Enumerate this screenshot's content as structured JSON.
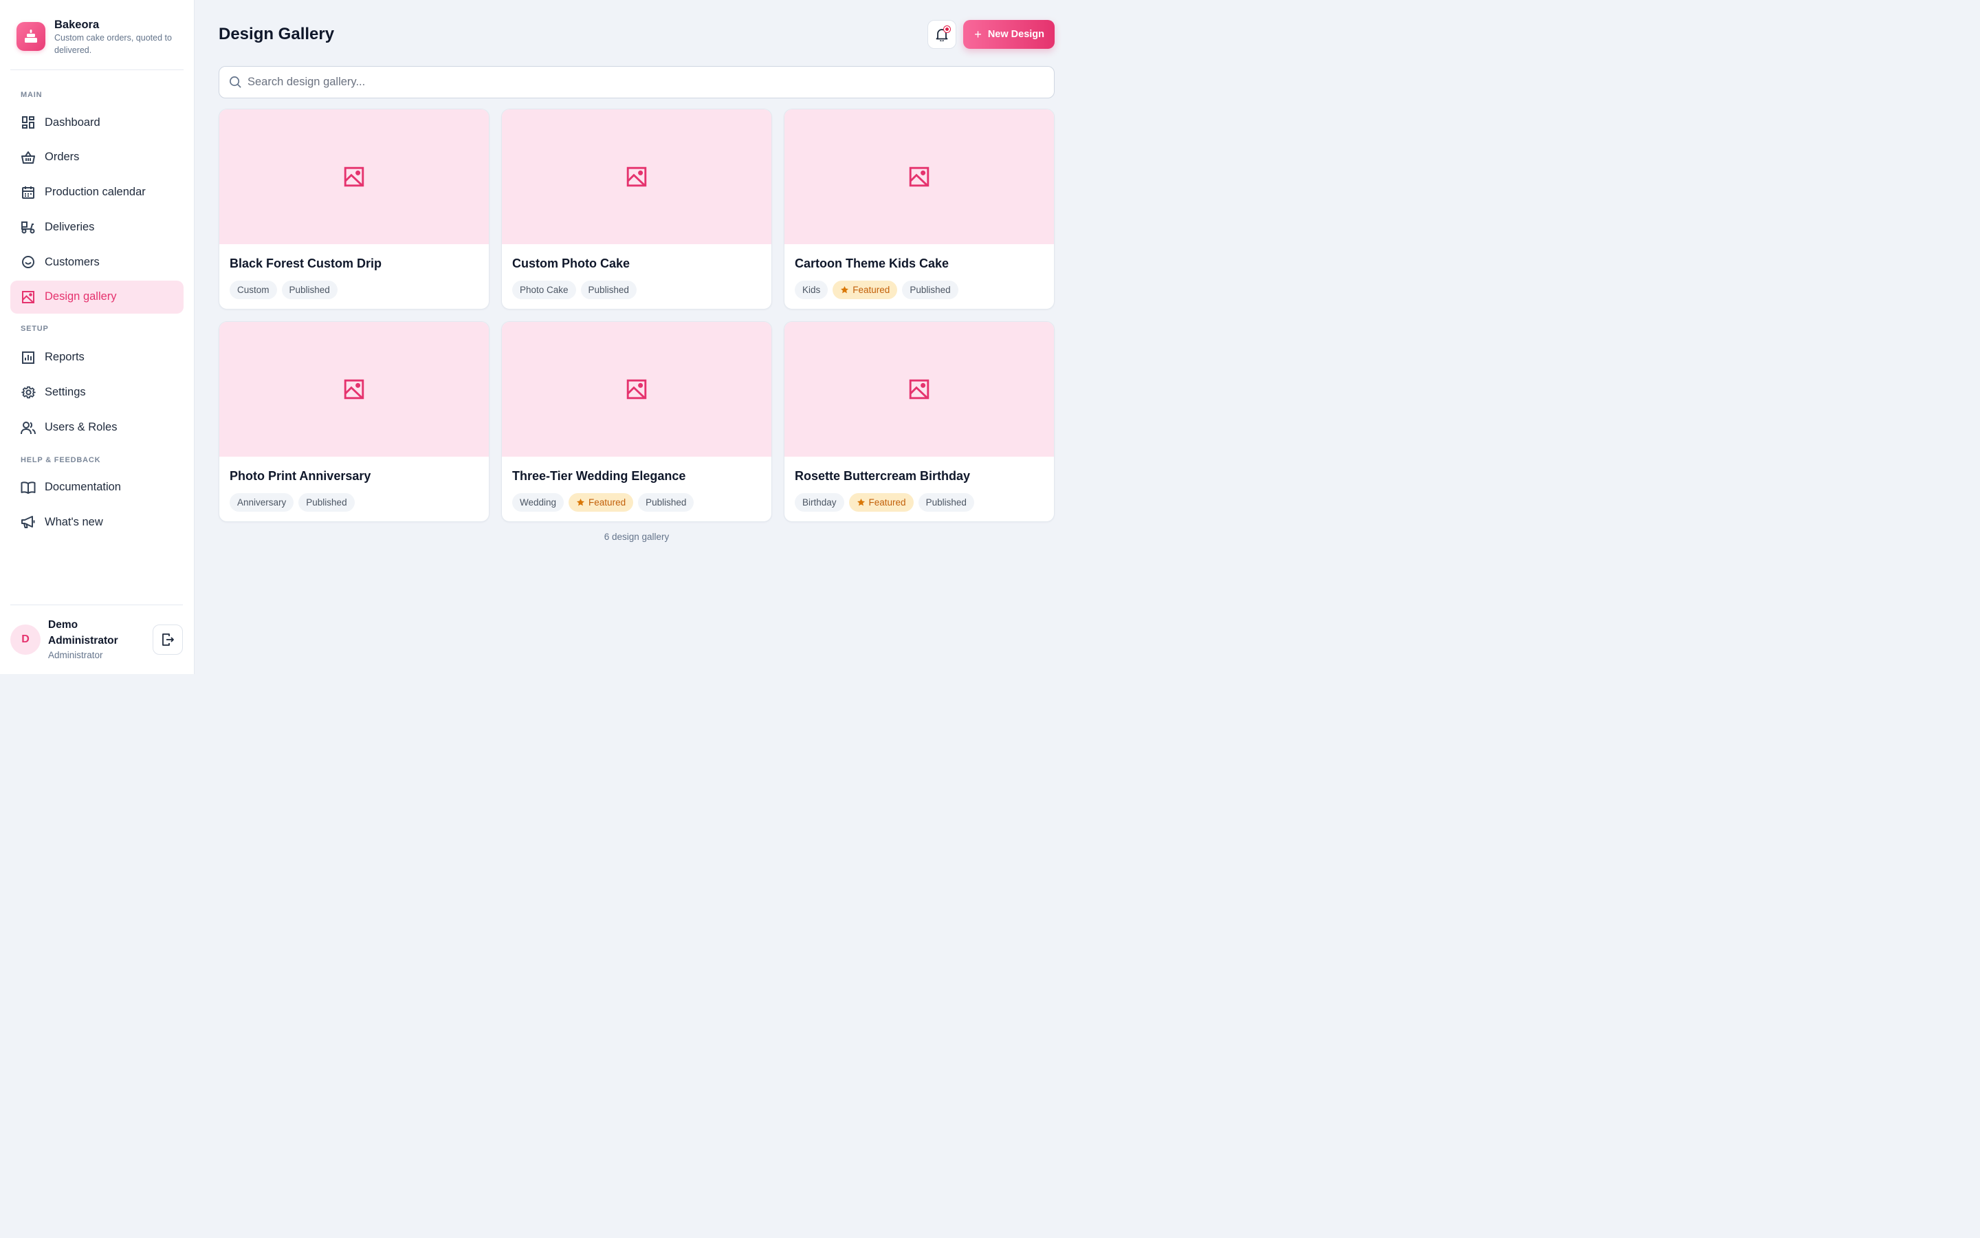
{
  "brand": {
    "name": "Bakeora",
    "tagline": "Custom cake orders, quoted to delivered."
  },
  "nav": {
    "main_label": "MAIN",
    "setup_label": "SETUP",
    "help_label": "HELP & FEEDBACK",
    "main_items": [
      {
        "label": "Dashboard",
        "icon": "dashboard-icon"
      },
      {
        "label": "Orders",
        "icon": "basket-icon"
      },
      {
        "label": "Production calendar",
        "icon": "calendar-icon"
      },
      {
        "label": "Deliveries",
        "icon": "delivery-scooter-icon"
      },
      {
        "label": "Customers",
        "icon": "smile-icon"
      },
      {
        "label": "Design gallery",
        "icon": "image-icon",
        "active": true
      }
    ],
    "setup_items": [
      {
        "label": "Reports",
        "icon": "bar-chart-icon"
      },
      {
        "label": "Settings",
        "icon": "gear-icon"
      },
      {
        "label": "Users & Roles",
        "icon": "users-icon"
      }
    ],
    "help_items": [
      {
        "label": "Documentation",
        "icon": "book-icon"
      },
      {
        "label": "What's new",
        "icon": "megaphone-icon"
      }
    ]
  },
  "user": {
    "initial": "D",
    "name": "Demo Administrator",
    "role": "Administrator"
  },
  "header": {
    "title": "Design Gallery",
    "new_button": "New Design"
  },
  "search": {
    "placeholder": "Search design gallery..."
  },
  "designs": [
    {
      "title": "Black Forest Custom Drip",
      "category": "Custom",
      "featured": false,
      "status": "Published"
    },
    {
      "title": "Custom Photo Cake",
      "category": "Photo Cake",
      "featured": false,
      "status": "Published"
    },
    {
      "title": "Cartoon Theme Kids Cake",
      "category": "Kids",
      "featured": true,
      "status": "Published"
    },
    {
      "title": "Photo Print Anniversary",
      "category": "Anniversary",
      "featured": false,
      "status": "Published"
    },
    {
      "title": "Three-Tier Wedding Elegance",
      "category": "Wedding",
      "featured": true,
      "status": "Published"
    },
    {
      "title": "Rosette Buttercream Birthday",
      "category": "Birthday",
      "featured": true,
      "status": "Published"
    }
  ],
  "featured_label": "Featured",
  "count_text": "6 design gallery",
  "colors": {
    "accent": "#e5336e",
    "accent_light": "#fde3ee",
    "featured_bg": "#fdecc6",
    "featured_text": "#c2600a"
  }
}
